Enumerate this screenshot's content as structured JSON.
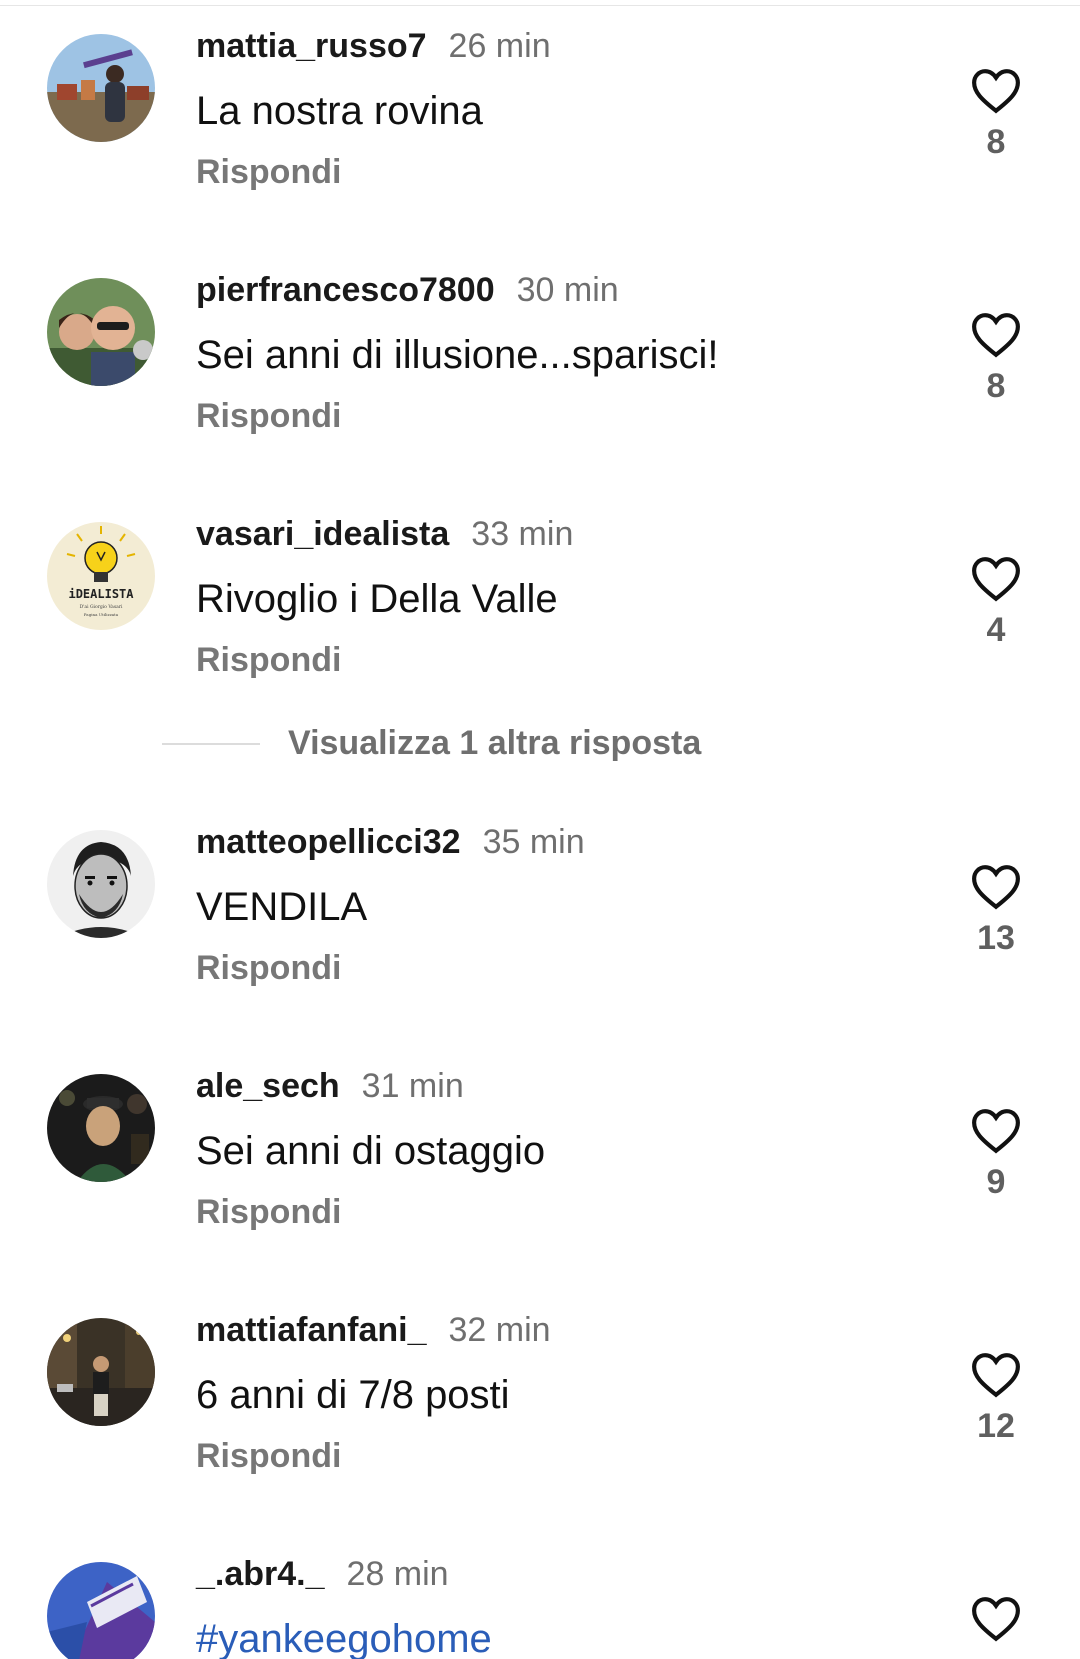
{
  "comments": [
    {
      "username": "mattia_russo7",
      "time": "26 min",
      "text": "La nostra rovina",
      "reply": "Rispondi",
      "likes": "8"
    },
    {
      "username": "pierfrancesco7800",
      "time": "30 min",
      "text": "Sei anni di illusione...sparisci!",
      "reply": "Rispondi",
      "likes": "8"
    },
    {
      "username": "vasari_idealista",
      "time": "33 min",
      "text": "Rivoglio i Della Valle",
      "reply": "Rispondi",
      "likes": "4"
    },
    {
      "username": "matteopellicci32",
      "time": "35 min",
      "text": "VENDILA",
      "reply": "Rispondi",
      "likes": "13"
    },
    {
      "username": "ale_sech",
      "time": "31 min",
      "text": "Sei anni di ostaggio",
      "reply": "Rispondi",
      "likes": "9"
    },
    {
      "username": "mattiafanfani_",
      "time": "32 min",
      "text": "6 anni di 7/8 posti",
      "reply": "Rispondi",
      "likes": "12"
    },
    {
      "username": "_.abr4._",
      "time": "28 min",
      "text": "#yankeegohome",
      "reply": "",
      "likes": ""
    }
  ],
  "view_more_replies": "Visualizza 1 altra risposta",
  "avatar_logo_text": {
    "line1": "iDEALISTA",
    "line2": "D'ai Giorgio Vasari",
    "line3": "Pagina Utilizzata"
  },
  "colors": {
    "username": "#1a1a1a",
    "secondary": "#6f6f6f",
    "hashtag": "#2a5db8",
    "heart_outline": "#111111"
  }
}
